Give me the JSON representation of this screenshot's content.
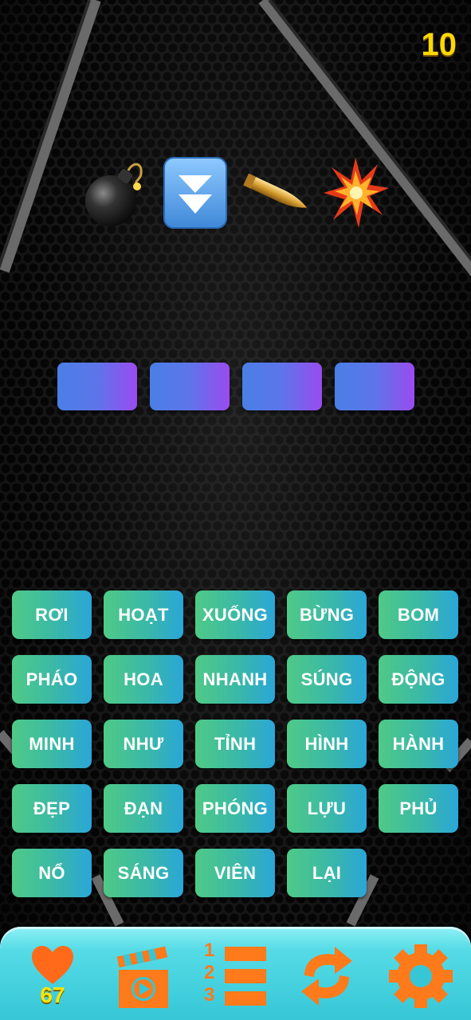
{
  "level": "10",
  "clues": [
    {
      "icon": "bomb-icon"
    },
    {
      "icon": "double-down-arrow-icon"
    },
    {
      "icon": "bullet-icon"
    },
    {
      "icon": "explosion-icon"
    }
  ],
  "answer_slots": 4,
  "words": [
    "RƠI",
    "HOẠT",
    "XUỐNG",
    "BỪNG",
    "BOM",
    "PHÁO",
    "HOA",
    "NHANH",
    "SÚNG",
    "ĐỘNG",
    "MINH",
    "NHƯ",
    "TỈNH",
    "HÌNH",
    "HÀNH",
    "ĐẸP",
    "ĐẠN",
    "PHÓNG",
    "LỰU",
    "PHỦ",
    "NỔ",
    "SÁNG",
    "VIÊN",
    "LẠI"
  ],
  "bottom_bar": {
    "lives": "67",
    "ranking_numbers": [
      "1",
      "2",
      "3"
    ]
  },
  "colors": {
    "level": "#ffd800",
    "slot_gradient": [
      "#4a7fe6",
      "#9a4bf0"
    ],
    "tile_gradient": [
      "#4fca86",
      "#2aa6d8"
    ],
    "bar": "#36c6d6",
    "icon_orange": "#ff7a1a"
  }
}
